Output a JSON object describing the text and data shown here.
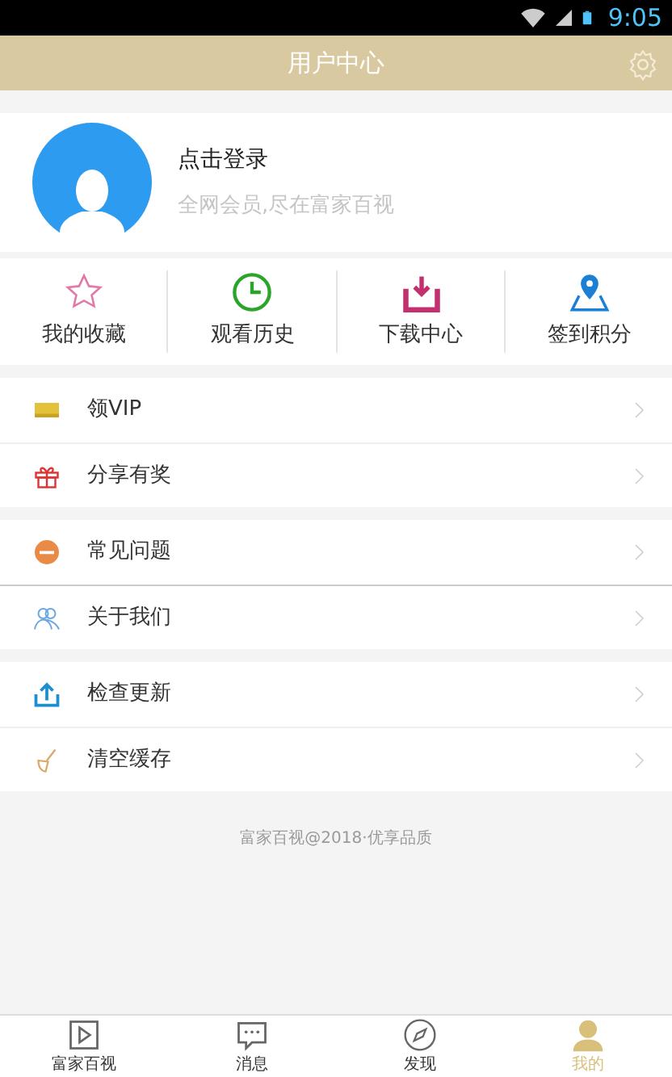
{
  "status_bar": {
    "time": "9:05"
  },
  "header": {
    "title": "用户中心"
  },
  "profile": {
    "login": "点击登录",
    "subtitle": "全网会员,尽在富家百视"
  },
  "shortcuts": [
    {
      "label": "我的收藏"
    },
    {
      "label": "观看历史"
    },
    {
      "label": "下载中心"
    },
    {
      "label": "签到积分"
    }
  ],
  "menu_groups": [
    {
      "items": [
        {
          "label": "领VIP"
        },
        {
          "label": "分享有奖"
        }
      ]
    },
    {
      "items": [
        {
          "label": "常见问题"
        },
        {
          "label": "关于我们"
        }
      ]
    },
    {
      "items": [
        {
          "label": "检查更新"
        },
        {
          "label": "清空缓存"
        }
      ]
    }
  ],
  "footer": "富家百视@2018·优享品质",
  "bottom_nav": [
    {
      "label": "富家百视",
      "selected": false
    },
    {
      "label": "消息",
      "selected": false
    },
    {
      "label": "发现",
      "selected": false
    },
    {
      "label": "我的",
      "selected": true
    }
  ]
}
